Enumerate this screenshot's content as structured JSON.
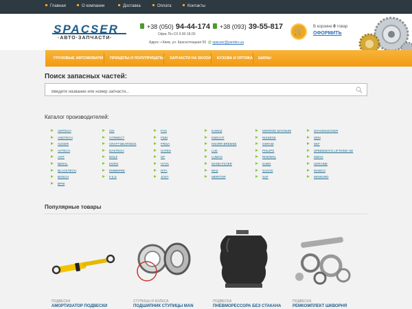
{
  "topnav": [
    "Главная",
    "О компании",
    "Доставка",
    "Оплата",
    "Контакты"
  ],
  "logo": {
    "main": "SPACSER",
    "sub": "·АВТО·ЗАПЧАСТИ·"
  },
  "header": {
    "phone1_code": "+38 (050)",
    "phone1_num": "94-44-174",
    "phone2_code": "+38 (093)",
    "phone2_num": "39-55-817",
    "hours": "Офис Пн-Сб 9.00-18.00",
    "address": "Адрес: г.Киев, ул. Красноткацкая 59",
    "email": "spacser@yandex.ua",
    "cart_pre": "В корзине ",
    "cart_count": "0",
    "cart_post": " товар",
    "checkout": "ОФОРМИТЬ"
  },
  "catnav": [
    "ГРУЗОВЫЕ АВТОМОБИЛИ",
    "ПРИЦЕПЫ И ПОЛУПРИЦЕПЫ",
    "ЗАПЧАСТИ НА SKODA",
    "КУЗОВА И ОПТИКА",
    "ШИНЫ"
  ],
  "search": {
    "title": "Поиск запасных частей:",
    "placeholder": "Введите название или номер запчасти..."
  },
  "catalog": {
    "title": "Каталог производителей:",
    "columns": [
      [
        "AIRTECH",
        "ANDTECH",
        "AUGER",
        "AVTECH",
        "AXIT",
        "BERAL",
        "BLACKTECH",
        "BOSCH",
        "BPW"
      ],
      [
        "CEI",
        "CONNECT",
        "CRAFT-BEARINGS",
        "DASTECH",
        "DOLZ",
        "EGRO",
        "EMMERRE",
        "F.S.S"
      ],
      [
        "FAG",
        "FEBI",
        "FRISA",
        "GATES",
        "GF",
        "HYVA",
        "ISTA",
        "JOST"
      ],
      [
        "KAMAZ",
        "KNECHT",
        "KNORR BREMSE",
        "LUK",
        "LUMAG",
        "MANN-FILTER",
        "MAZ",
        "MERITOR"
      ],
      [
        "MONROE MAGNUM",
        "NISSENS",
        "OSRAM",
        "PHILIPS",
        "RHEINOL",
        "SABO",
        "SACHS",
        "SAF"
      ],
      [
        "SCHOMAECKER",
        "SEM",
        "SKF",
        "SPEEDWAYS LIFTKING HD",
        "SWAG",
        "UKRAINE",
        "WABCO",
        "WINNARD"
      ]
    ]
  },
  "popular": {
    "title": "Популярные товары",
    "items": [
      {
        "category": "ПОДВЕСКА",
        "name": "АМОРТИЗАТОР ПОДВЕСКИ"
      },
      {
        "category": "СТУПИЦЫ И КОЛЕСА",
        "name": "ПОДШИПНИК СТУПИЦЫ MAN"
      },
      {
        "category": "ПОДВЕСКА",
        "name": "ПНЕВМОРЕССОРА БЕЗ СТАКАНА"
      },
      {
        "category": "ПОДВЕСКА",
        "name": "РЕМКОМПЛЕКТ ШКВОРНЯ"
      }
    ]
  },
  "colors": {
    "accent": "#f29a12",
    "link": "#1b6c8e",
    "topbar": "#2e3a42",
    "bullet": "#8cc63f"
  }
}
